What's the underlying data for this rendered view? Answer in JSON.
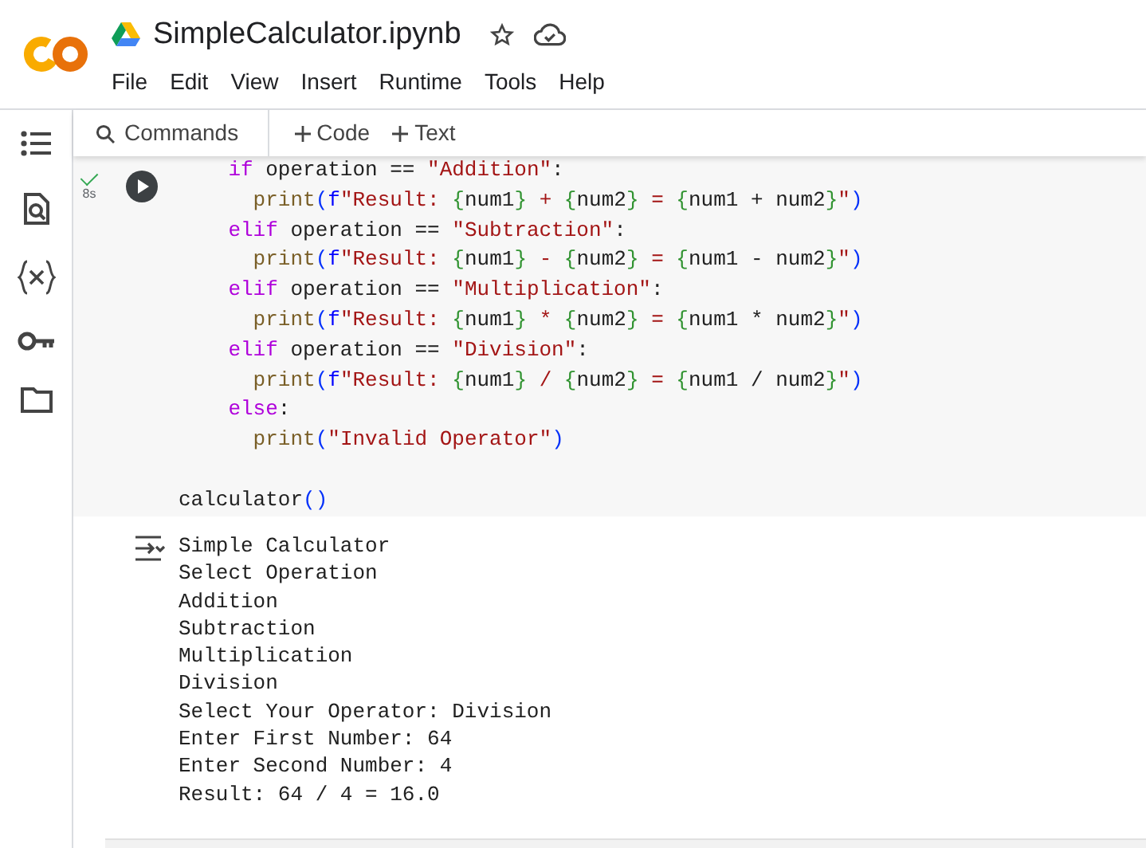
{
  "header": {
    "title": "SimpleCalculator.ipynb",
    "menu": [
      "File",
      "Edit",
      "View",
      "Insert",
      "Runtime",
      "Tools",
      "Help"
    ]
  },
  "toolbar": {
    "search": "Commands",
    "buttons": [
      "Code",
      "Text"
    ]
  },
  "cell": {
    "status": "8s",
    "succeeded": true,
    "code_lines": [
      {
        "kind": "code",
        "tokens": [
          {
            "kind": "kw",
            "text": "    if"
          },
          {
            "kind": "plain",
            "text": " operation == "
          },
          {
            "kind": "str",
            "text": "\"Addition\""
          },
          {
            "kind": "plain",
            "text": ":"
          }
        ]
      },
      {
        "kind": "code",
        "tokens": [
          {
            "kind": "fn",
            "text": "      print"
          },
          {
            "kind": "paren",
            "text": "("
          },
          {
            "kind": "prefix",
            "text": "f"
          },
          {
            "kind": "str",
            "text": "\"Result: "
          },
          {
            "kind": "brace",
            "text": "{"
          },
          {
            "kind": "plain",
            "text": "num1"
          },
          {
            "kind": "brace",
            "text": "}"
          },
          {
            "kind": "str",
            "text": " + "
          },
          {
            "kind": "brace",
            "text": "{"
          },
          {
            "kind": "plain",
            "text": "num2"
          },
          {
            "kind": "brace",
            "text": "}"
          },
          {
            "kind": "str",
            "text": " = "
          },
          {
            "kind": "brace",
            "text": "{"
          },
          {
            "kind": "plain",
            "text": "num1 + num2"
          },
          {
            "kind": "brace",
            "text": "}"
          },
          {
            "kind": "str",
            "text": "\""
          },
          {
            "kind": "paren",
            "text": ")"
          }
        ]
      },
      {
        "kind": "code",
        "tokens": [
          {
            "kind": "kw",
            "text": "    elif"
          },
          {
            "kind": "plain",
            "text": " operation == "
          },
          {
            "kind": "str",
            "text": "\"Subtraction\""
          },
          {
            "kind": "plain",
            "text": ":"
          }
        ]
      },
      {
        "kind": "code",
        "tokens": [
          {
            "kind": "fn",
            "text": "      print"
          },
          {
            "kind": "paren",
            "text": "("
          },
          {
            "kind": "prefix",
            "text": "f"
          },
          {
            "kind": "str",
            "text": "\"Result: "
          },
          {
            "kind": "brace",
            "text": "{"
          },
          {
            "kind": "plain",
            "text": "num1"
          },
          {
            "kind": "brace",
            "text": "}"
          },
          {
            "kind": "str",
            "text": " - "
          },
          {
            "kind": "brace",
            "text": "{"
          },
          {
            "kind": "plain",
            "text": "num2"
          },
          {
            "kind": "brace",
            "text": "}"
          },
          {
            "kind": "str",
            "text": " = "
          },
          {
            "kind": "brace",
            "text": "{"
          },
          {
            "kind": "plain",
            "text": "num1 - num2"
          },
          {
            "kind": "brace",
            "text": "}"
          },
          {
            "kind": "str",
            "text": "\""
          },
          {
            "kind": "paren",
            "text": ")"
          }
        ]
      },
      {
        "kind": "code",
        "tokens": [
          {
            "kind": "kw",
            "text": "    elif"
          },
          {
            "kind": "plain",
            "text": " operation == "
          },
          {
            "kind": "str",
            "text": "\"Multiplication\""
          },
          {
            "kind": "plain",
            "text": ":"
          }
        ]
      },
      {
        "kind": "code",
        "tokens": [
          {
            "kind": "fn",
            "text": "      print"
          },
          {
            "kind": "paren",
            "text": "("
          },
          {
            "kind": "prefix",
            "text": "f"
          },
          {
            "kind": "str",
            "text": "\"Result: "
          },
          {
            "kind": "brace",
            "text": "{"
          },
          {
            "kind": "plain",
            "text": "num1"
          },
          {
            "kind": "brace",
            "text": "}"
          },
          {
            "kind": "str",
            "text": " * "
          },
          {
            "kind": "brace",
            "text": "{"
          },
          {
            "kind": "plain",
            "text": "num2"
          },
          {
            "kind": "brace",
            "text": "}"
          },
          {
            "kind": "str",
            "text": " = "
          },
          {
            "kind": "brace",
            "text": "{"
          },
          {
            "kind": "plain",
            "text": "num1 * num2"
          },
          {
            "kind": "brace",
            "text": "}"
          },
          {
            "kind": "str",
            "text": "\""
          },
          {
            "kind": "paren",
            "text": ")"
          }
        ]
      },
      {
        "kind": "code",
        "tokens": [
          {
            "kind": "kw",
            "text": "    elif"
          },
          {
            "kind": "plain",
            "text": " operation == "
          },
          {
            "kind": "str",
            "text": "\"Division\""
          },
          {
            "kind": "plain",
            "text": ":"
          }
        ]
      },
      {
        "kind": "code",
        "tokens": [
          {
            "kind": "fn",
            "text": "      print"
          },
          {
            "kind": "paren",
            "text": "("
          },
          {
            "kind": "prefix",
            "text": "f"
          },
          {
            "kind": "str",
            "text": "\"Result: "
          },
          {
            "kind": "brace",
            "text": "{"
          },
          {
            "kind": "plain",
            "text": "num1"
          },
          {
            "kind": "brace",
            "text": "}"
          },
          {
            "kind": "str",
            "text": " / "
          },
          {
            "kind": "brace",
            "text": "{"
          },
          {
            "kind": "plain",
            "text": "num2"
          },
          {
            "kind": "brace",
            "text": "}"
          },
          {
            "kind": "str",
            "text": " = "
          },
          {
            "kind": "brace",
            "text": "{"
          },
          {
            "kind": "plain",
            "text": "num1 / num2"
          },
          {
            "kind": "brace",
            "text": "}"
          },
          {
            "kind": "str",
            "text": "\""
          },
          {
            "kind": "paren",
            "text": ")"
          }
        ]
      },
      {
        "kind": "code",
        "tokens": [
          {
            "kind": "kw",
            "text": "    else"
          },
          {
            "kind": "plain",
            "text": ":"
          }
        ]
      },
      {
        "kind": "code",
        "tokens": [
          {
            "kind": "fn",
            "text": "      print"
          },
          {
            "kind": "paren",
            "text": "("
          },
          {
            "kind": "str",
            "text": "\"Invalid Operator\""
          },
          {
            "kind": "paren",
            "text": ")"
          }
        ]
      },
      {
        "kind": "blank"
      },
      {
        "kind": "code",
        "tokens": [
          {
            "kind": "plain",
            "text": "calculator"
          },
          {
            "kind": "paren",
            "text": "()"
          }
        ]
      }
    ],
    "output": [
      "Simple Calculator",
      "Select Operation",
      "Addition",
      "Subtraction",
      "Multiplication",
      "Division",
      "Select Your Operator: Division",
      "Enter First Number: 64",
      "Enter Second Number: 4",
      "Result: 64 / 4 = 16.0"
    ]
  }
}
